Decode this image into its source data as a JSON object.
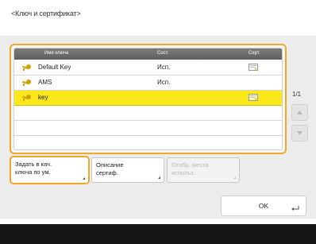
{
  "screen": {
    "title": "<Ключ и сертификат>"
  },
  "list": {
    "columns": {
      "name": "Имя ключа",
      "status": "Сост.",
      "cert": "Серт."
    },
    "rows": [
      {
        "name": "Default Key",
        "status": "Исп.",
        "has_cert": true,
        "selected": false
      },
      {
        "name": "AMS",
        "status": "Исп.",
        "has_cert": false,
        "selected": false
      },
      {
        "name": "key",
        "status": "",
        "has_cert": true,
        "selected": true
      }
    ],
    "page_indicator": "1/1"
  },
  "buttons": {
    "set_default": {
      "line1": "Задать в кач.",
      "line2": "ключа по ум."
    },
    "cert_details": {
      "line1": "Описание",
      "line2": "сертиф."
    },
    "show_location": {
      "line1": "Отобр. места",
      "line2": "использ."
    },
    "ok": "OK"
  },
  "colors": {
    "accent_orange": "#f0a828",
    "selected_row": "#fbe81a",
    "header_bg": "#6c6c6c",
    "bottom_bar": "#151515"
  },
  "icons": {
    "row_icon": "key-icon",
    "cert_icon": "certificate-icon",
    "scroll_up": "scroll-up-icon",
    "scroll_down": "scroll-down-icon",
    "ok_icon": "return-icon"
  }
}
